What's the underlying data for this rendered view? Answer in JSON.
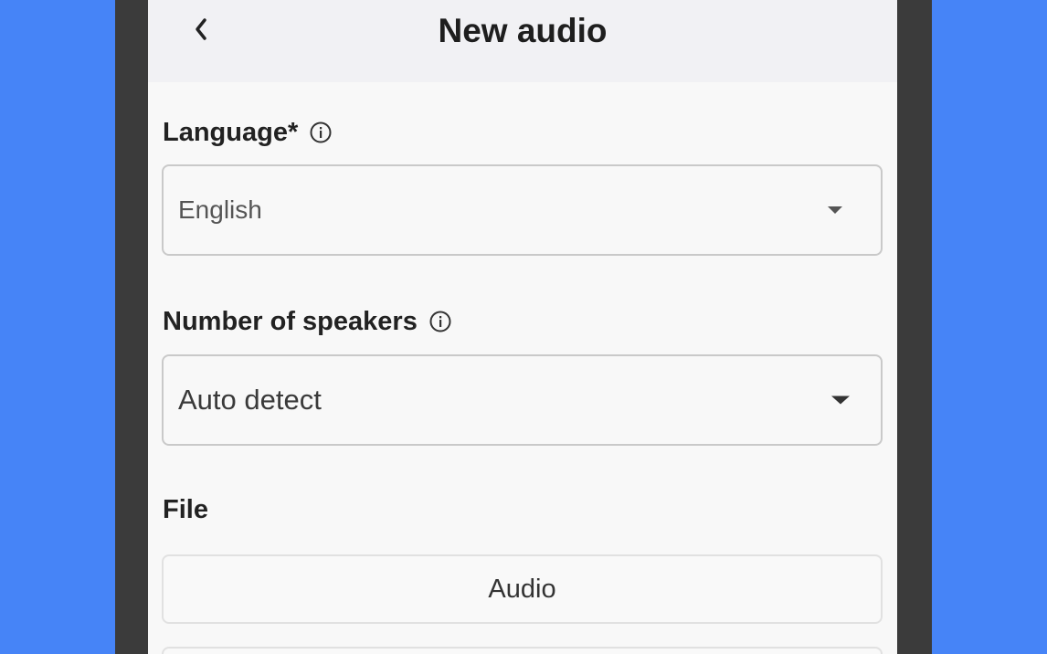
{
  "header": {
    "back_icon": "chevron-left-icon",
    "title": "New audio"
  },
  "form": {
    "language": {
      "label": "Language*",
      "info_icon": "info-circle-icon",
      "selected": "English",
      "dropdown_icon": "caret-down-icon"
    },
    "speakers": {
      "label": "Number of speakers",
      "info_icon": "info-circle-icon",
      "selected": "Auto detect",
      "dropdown_icon": "caret-down-icon"
    },
    "file": {
      "label": "File",
      "audio_button": "Audio"
    }
  },
  "colors": {
    "background": "#4684f7",
    "phone_frame": "#3b3b3b",
    "screen": "#f8f8f8",
    "appbar": "#f1f1f4"
  }
}
